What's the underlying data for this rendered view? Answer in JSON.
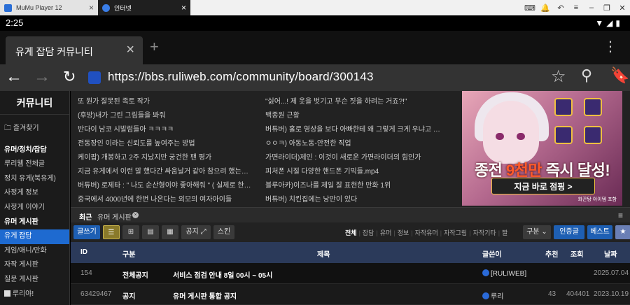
{
  "emulator": {
    "tab1_title": "MuMu Player 12",
    "tab2_title": "인터넷",
    "controls": [
      "keyboard-icon",
      "notification-icon",
      "back-icon",
      "menu-icon",
      "minimize-icon",
      "restore-icon",
      "close-icon"
    ]
  },
  "status_bar": {
    "time": "2:25",
    "icons": "wifi-icon signal-icon battery-icon"
  },
  "browser": {
    "tab_title": "유게 잡담 커뮤니티",
    "url": "https://bbs.ruliweb.com/community/board/300143"
  },
  "sidebar": {
    "title": "커뮤니티",
    "items": [
      {
        "label": "즐겨찾기",
        "kind": "folder"
      },
      {
        "label": "유머/정치/잡담",
        "kind": "head"
      },
      {
        "label": "루리웹 전체글",
        "kind": "item"
      },
      {
        "label": "정치 유게(북유게)",
        "kind": "item"
      },
      {
        "label": "사정게 정보",
        "kind": "item"
      },
      {
        "label": "사정게 이야기",
        "kind": "item"
      },
      {
        "label": "유머 게시판",
        "kind": "head"
      },
      {
        "label": "유게 잡담",
        "kind": "active"
      },
      {
        "label": "게임/애니/만화",
        "kind": "item"
      },
      {
        "label": "자작 게시판",
        "kind": "item"
      },
      {
        "label": "질문 게시판",
        "kind": "item"
      },
      {
        "label": "루리야!",
        "kind": "item"
      }
    ]
  },
  "links": {
    "left": [
      "또 뭔가 잘못된 족토 작가",
      "(후방)내가 그린 그림들을 봐줘",
      "반다이 남코 시발럼들아 ㅋㅋㅋㅋ",
      "전동장인 이라는 신뢰도를 높여주는 방법",
      "케이팝) 개봉하고 2주 지났지만 궁건한 팬 평가",
      "지금 유게에서 이런 말 했다간 싸움날거 같아 참으려 했는…",
      "버튜버) 로제타 : \" 나도 순산형이야 좋아해줘 \" ( 실제로 한…",
      "중국에서 4000년에 한번 나온다는 외모의 여자아이들"
    ],
    "right": [
      "\"싫어...! 제 옷을 벗기고 무슨 짓을 하려는 거죠?!\"",
      "백종원 근황",
      "버튜버) 홀로 영상을 보다 아빠한테 왜 그렇게 크게 우냐고 …",
      "ㅇㅇㅋ) 아동노동-안전한 직업",
      "가면라이더)제인 : 이것이 새로운 가면라이더의 힘인가",
      "피처폰 시절 다양한 핸드폰 기믹들.mp4",
      "블루아카)이즈나를 제일 잘 표현한 만화 1위",
      "버튜버) 치킨집에는 낭만이 있다"
    ]
  },
  "ad": {
    "headline_pre": "종전 ",
    "headline_em": "9천만",
    "headline_post": " 즉시 달성!",
    "cta": "지금 바로 점핑 >",
    "fine": "화끈탕 아이템 포함"
  },
  "recent": {
    "label": "최근",
    "board": "유머 게시판"
  },
  "board_toolbar": {
    "write": "글쓰기",
    "notice": "공지 ⤢",
    "skin": "스킨",
    "categories": [
      "전체",
      "잡담",
      "유머",
      "정보",
      "자작유머",
      "자작그림",
      "자작기타",
      "짤"
    ],
    "select": "구분 ⌄",
    "auth": "인증글",
    "best": "베스트",
    "fav": "★"
  },
  "table": {
    "headers": [
      "ID",
      "구분",
      "제목",
      "글쓴이",
      "추천",
      "조회",
      "날짜"
    ],
    "rows": [
      {
        "id": "154",
        "type": "전체공지",
        "subject": "서비스 점검 안내 8일 00시 ~ 05시",
        "author": "[RULIWEB]",
        "rec": "",
        "views": "",
        "date": "2025.07.04"
      },
      {
        "id": "63429467",
        "type": "공지",
        "subject": "유머 게시판 통합 공지",
        "author": "루리",
        "rec": "43",
        "views": "404401",
        "date": "2023.10.19"
      }
    ]
  }
}
